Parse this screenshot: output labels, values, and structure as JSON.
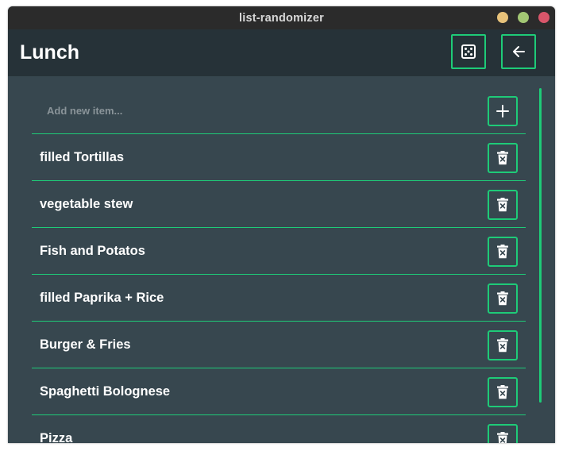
{
  "window": {
    "title": "list-randomizer",
    "controls": [
      {
        "name": "minimize-window-button",
        "color": "#e8c27a"
      },
      {
        "name": "maximize-window-button",
        "color": "#a3c774"
      },
      {
        "name": "close-window-button",
        "color": "#d9566a"
      }
    ]
  },
  "header": {
    "title": "Lunch",
    "randomize_icon": "dice-icon",
    "back_icon": "arrow-left-icon"
  },
  "new_item": {
    "placeholder": "Add new item...",
    "value": "",
    "add_icon": "plus-icon"
  },
  "items": [
    {
      "label": "filled Tortillas"
    },
    {
      "label": "vegetable stew"
    },
    {
      "label": "Fish and Potatos"
    },
    {
      "label": "filled Paprika + Rice"
    },
    {
      "label": "Burger & Fries"
    },
    {
      "label": "Spaghetti Bolognese"
    },
    {
      "label": "Pizza"
    }
  ],
  "item_delete_icon": "trash-icon",
  "colors": {
    "accent": "#1ecb78",
    "background": "#37474f",
    "header": "#263238",
    "titlebar": "#2b2b2b"
  }
}
